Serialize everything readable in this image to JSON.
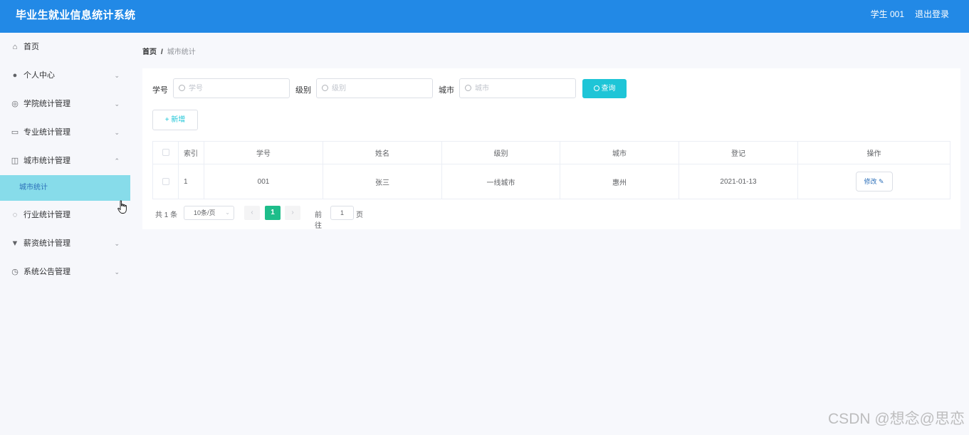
{
  "header": {
    "title": "毕业生就业信息统计系统",
    "user": "学生 001",
    "logout": "退出登录"
  },
  "sidebar": {
    "items": [
      {
        "label": "首页",
        "icon": "home-icon",
        "glyph": "⌂",
        "chevron": ""
      },
      {
        "label": "个人中心",
        "icon": "user-icon",
        "glyph": "●",
        "chevron": "⌄"
      },
      {
        "label": "学院统计管理",
        "icon": "globe-icon",
        "glyph": "◎",
        "chevron": "⌄"
      },
      {
        "label": "专业统计管理",
        "icon": "chat-icon",
        "glyph": "▭",
        "chevron": "⌄"
      },
      {
        "label": "城市统计管理",
        "icon": "copy-icon",
        "glyph": "◫",
        "chevron": "⌃"
      },
      {
        "label": "行业统计管理",
        "icon": "power-icon",
        "glyph": "◌",
        "chevron": ""
      },
      {
        "label": "薪资统计管理",
        "icon": "cup-icon",
        "glyph": "▼",
        "chevron": "⌄"
      },
      {
        "label": "系统公告管理",
        "icon": "gauge-icon",
        "glyph": "◷",
        "chevron": "⌄"
      }
    ],
    "subitem": "城市统计"
  },
  "breadcrumb": {
    "home": "首页",
    "separator": "/",
    "current": "城市统计"
  },
  "filters": [
    {
      "label": "学号",
      "placeholder": "学号"
    },
    {
      "label": "级别",
      "placeholder": "级别"
    },
    {
      "label": "城市",
      "placeholder": "城市"
    }
  ],
  "buttons": {
    "query": "查询",
    "add": "+ 新增"
  },
  "table": {
    "headers": [
      "索引",
      "学号",
      "姓名",
      "级别",
      "城市",
      "登记",
      "操作"
    ],
    "rows": [
      {
        "index": "1",
        "student_id": "001",
        "name": "张三",
        "level": "一线城市",
        "city": "惠州",
        "date": "2021-01-13",
        "action": "修改 ✎"
      }
    ]
  },
  "pagination": {
    "total": "共 1 条",
    "page_size": "10条/页",
    "prev": "‹",
    "current": "1",
    "next": "›",
    "goto": "前往",
    "goto_value": "1",
    "unit": "页"
  },
  "watermark": "CSDN @想念@思恋",
  "colors": {
    "header": "#2289e6",
    "active_menu": "#87dcea",
    "query_button": "#1ec5d7",
    "page_active": "#1ebd8a"
  }
}
